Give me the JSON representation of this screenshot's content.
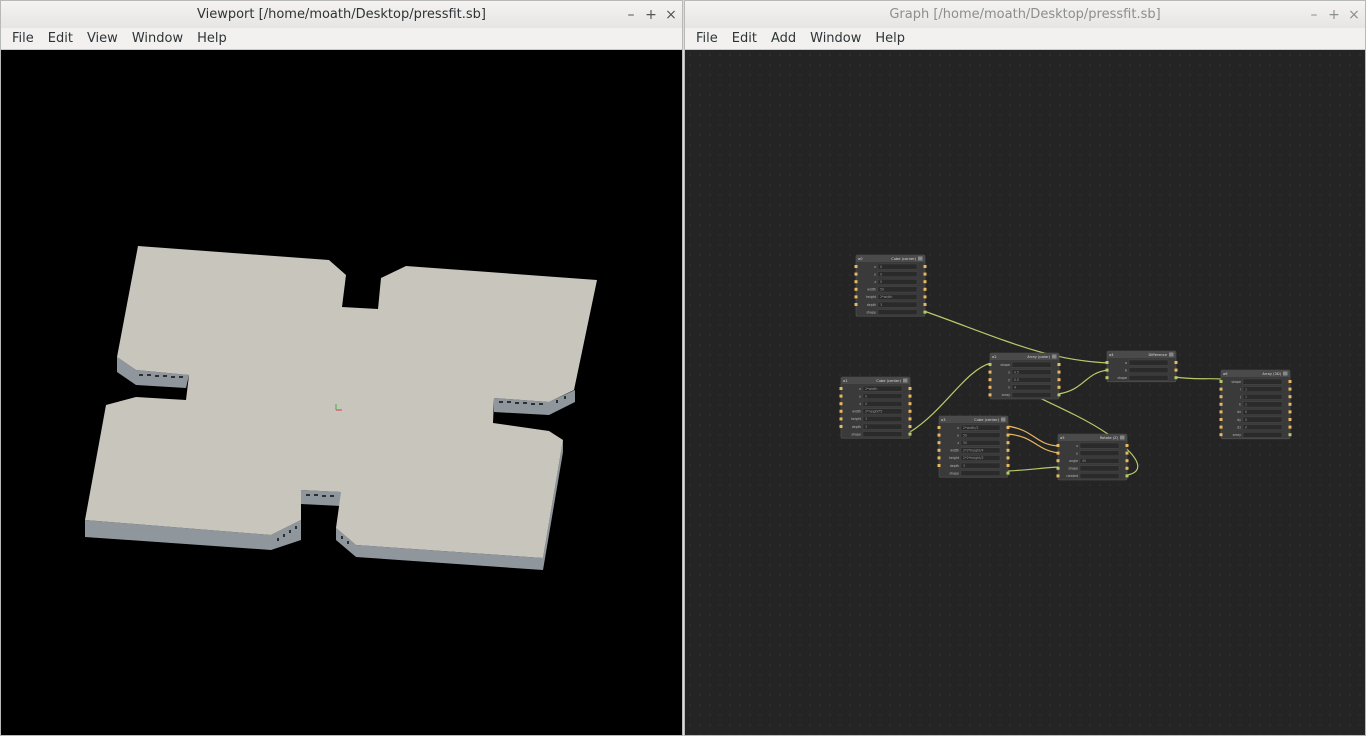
{
  "viewport": {
    "title": "Viewport [/home/moath/Desktop/pressfit.sb]",
    "menu": [
      "File",
      "Edit",
      "View",
      "Window",
      "Help"
    ],
    "controls": {
      "minimize": "–",
      "maximize": "+",
      "close": "×"
    },
    "background_color": "#000000"
  },
  "graph": {
    "title": "Graph [/home/moath/Desktop/pressfit.sb]",
    "menu": [
      "File",
      "Edit",
      "Add",
      "Window",
      "Help"
    ],
    "controls": {
      "minimize": "–",
      "maximize": "+",
      "close": "×"
    },
    "nodes": {
      "a0": {
        "id": "a0",
        "title": "Cube (corner)",
        "ports": [
          "x",
          "y",
          "z",
          "width",
          "height",
          "depth",
          "shape"
        ],
        "values": [
          "0",
          "0",
          "0",
          "50",
          "2*width",
          "3",
          ""
        ]
      },
      "a1": {
        "id": "a1",
        "title": "Cube (center)",
        "ports": [
          "x",
          "y",
          "z",
          "width",
          "height",
          "depth",
          "shape"
        ],
        "values": [
          "2*width",
          "0",
          "0",
          "2*height*5",
          "3",
          "3",
          ""
        ]
      },
      "a2": {
        "id": "a2",
        "title": "Array (polar)",
        "ports": [
          "shape",
          "x",
          "y",
          "n",
          "array"
        ],
        "values": [
          "",
          "0.5",
          "0.5",
          "4",
          ""
        ]
      },
      "a3": {
        "id": "a3",
        "title": "Cube (center)",
        "ports": [
          "x",
          "y",
          "z",
          "width",
          "height",
          "depth",
          "shape"
        ],
        "values": [
          "2*width/2",
          "50",
          "50",
          "2*2*height/4",
          "2*2*height/2",
          "3",
          ""
        ]
      },
      "a4": {
        "id": "a4",
        "title": "Difference",
        "ports": [
          "a",
          "b",
          "shape"
        ],
        "values": [
          "",
          "",
          ""
        ]
      },
      "a5": {
        "id": "a5",
        "title": "Rotate (Z)",
        "ports": [
          "x",
          "y",
          "angle",
          "shape",
          "rotated"
        ],
        "values": [
          "",
          "",
          "45",
          "",
          ""
        ]
      },
      "a6": {
        "id": "a6",
        "title": "Array (3D)",
        "ports": [
          "shape",
          "i",
          "j",
          "k",
          "dx",
          "dy",
          "dz",
          "array"
        ],
        "values": [
          "",
          "1",
          "1",
          "1",
          "0",
          "0",
          "0",
          ""
        ]
      }
    }
  }
}
